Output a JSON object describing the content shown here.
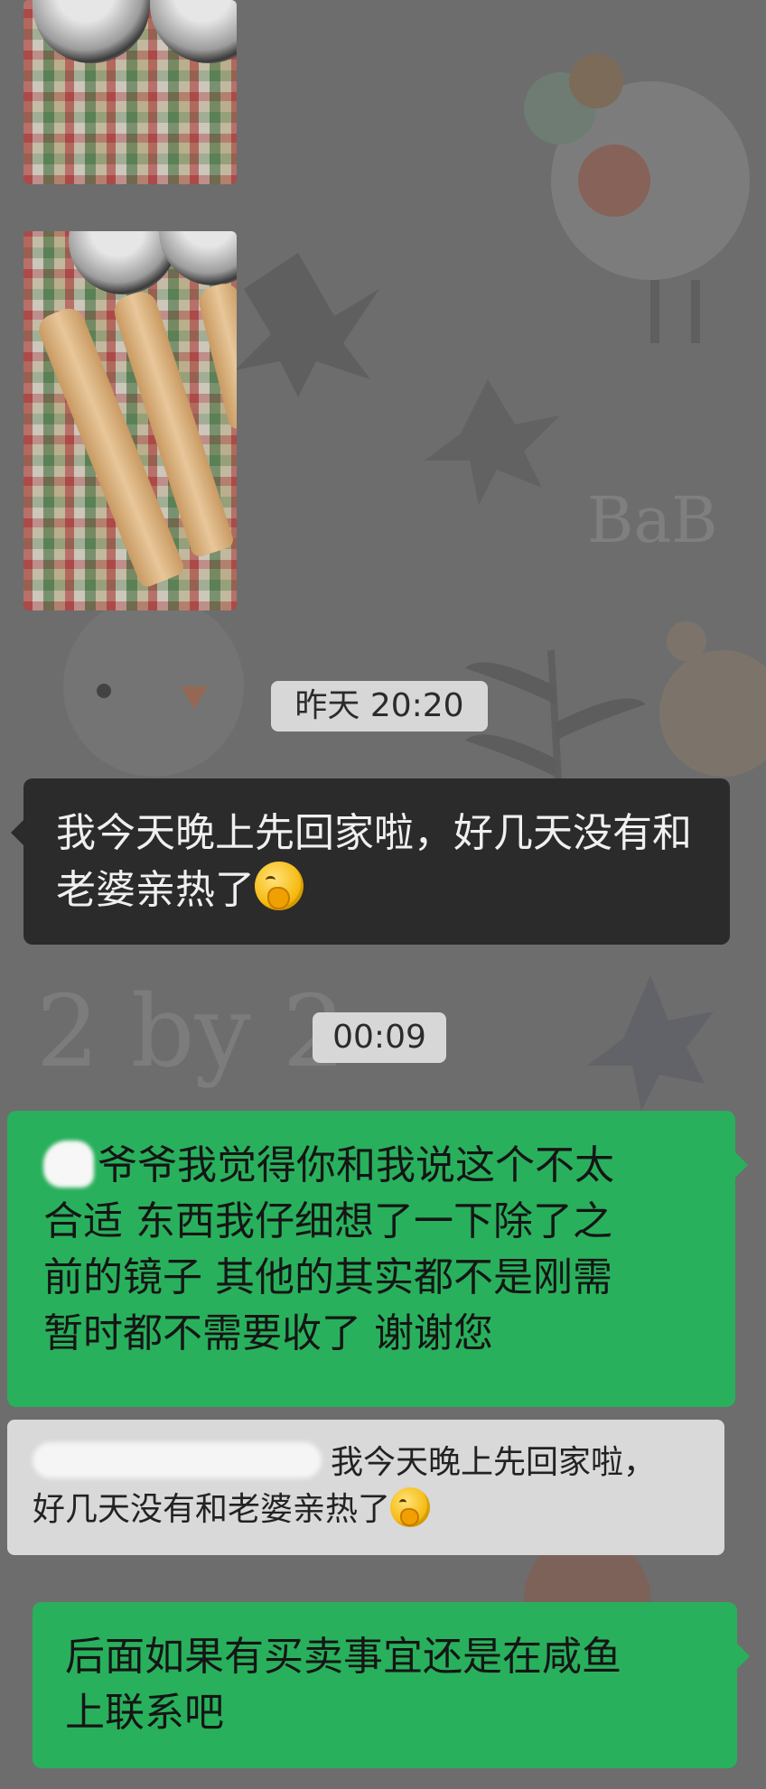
{
  "chat": {
    "timestamps": [
      "昨天 20:20",
      "00:09"
    ],
    "messages": [
      {
        "side": "left",
        "text": "我今天晚上先回家啦，好几天没有和老婆亲热了",
        "emoji": "thinking-face-icon"
      },
      {
        "side": "right",
        "line1": "爷爷我觉得你和我说这个不太",
        "line2": "合适 东西我仔细想了一下除了之",
        "line3": "前的镜子 其他的其实都不是刚需",
        "line4": "暂时都不需要收了 谢谢您"
      },
      {
        "side": "right",
        "line1": "后面如果有买卖事宜还是在咸鱼",
        "line2": "上联系吧"
      }
    ],
    "quote": {
      "line1": "我今天晚上先回家啦，",
      "line2": "好几天没有和老婆亲热了",
      "emoji": "thinking-face-icon"
    }
  },
  "colors": {
    "wallpaper": "#6d6d6d",
    "bubble_in": "#2b2b2b",
    "bubble_out": "#29b05c",
    "quote_bg": "#d9d9d9",
    "timestamp_bg": "#d7d7d7"
  }
}
